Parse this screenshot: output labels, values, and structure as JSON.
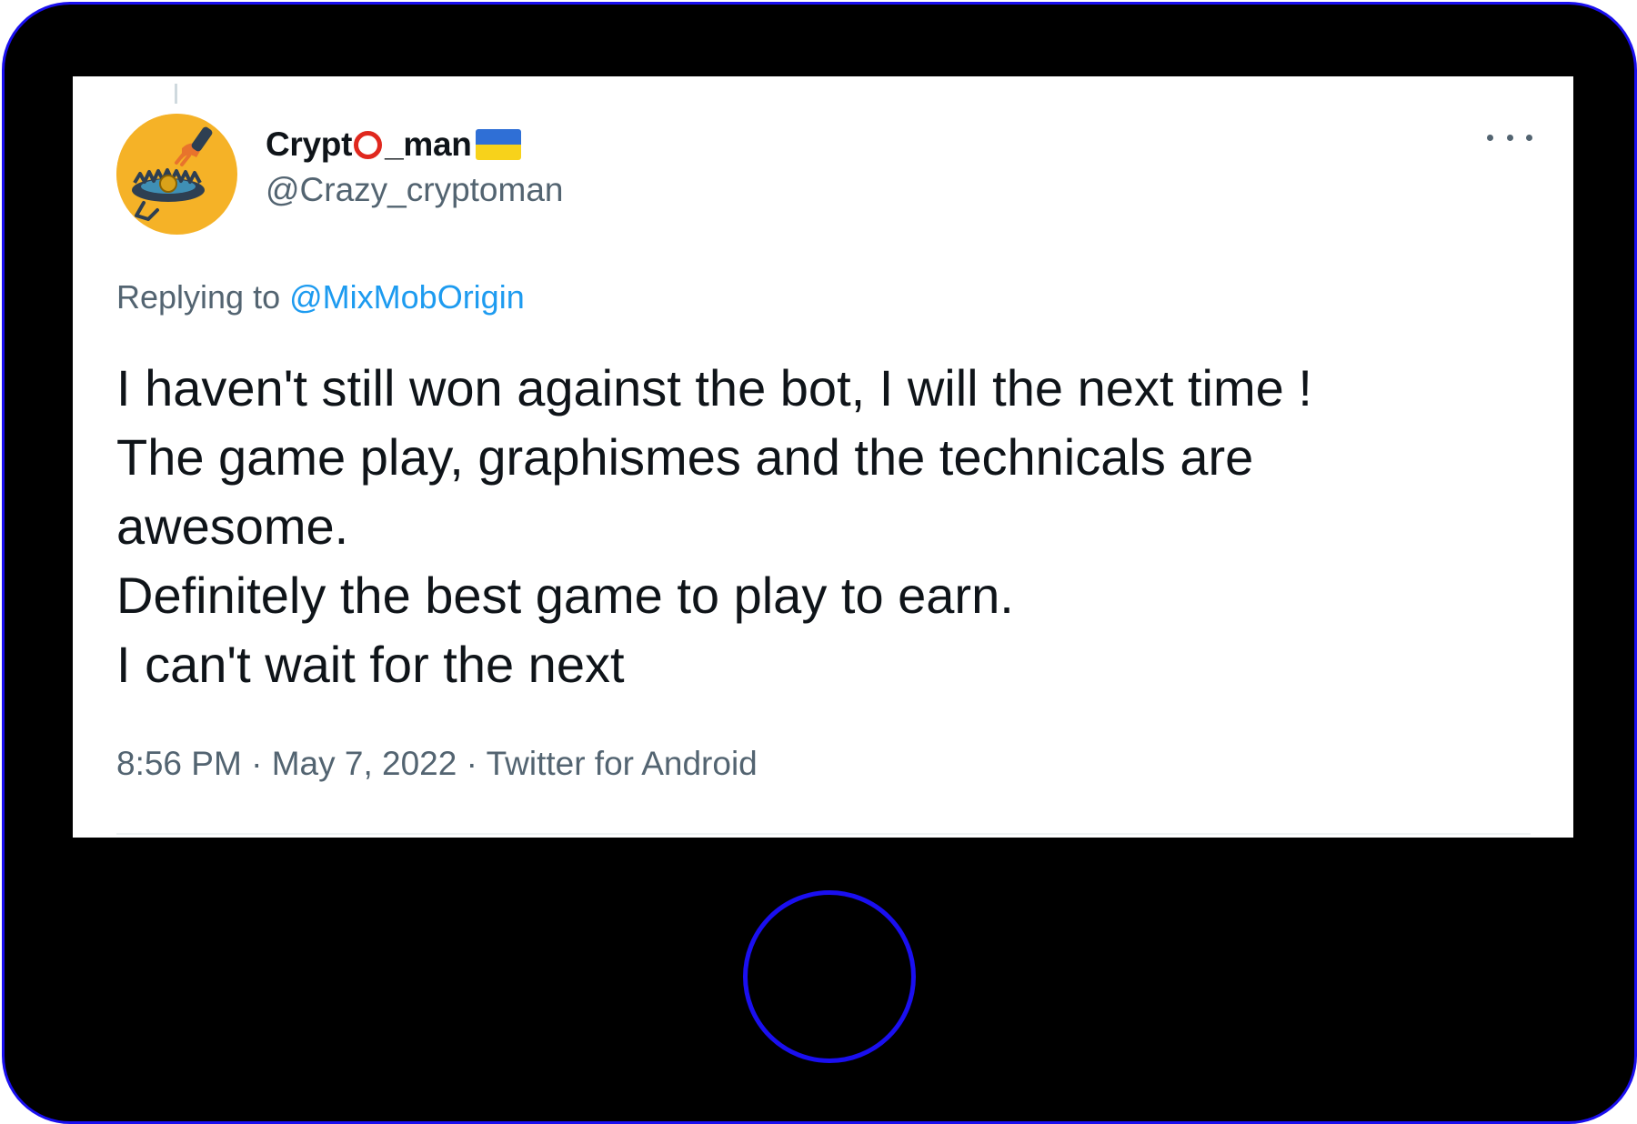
{
  "tweet": {
    "author": {
      "name_before": "Crypt",
      "name_after": "_man",
      "handle": "@Crazy_cryptoman",
      "avatar_icon": "bear-trap-icon",
      "name_emoji": [
        "red-circle-icon",
        "ukraine-flag-icon"
      ]
    },
    "reply": {
      "prefix": "Replying to",
      "mention": "@MixMobOrigin"
    },
    "text_lines": [
      "I haven't still won against the bot, I will the next time !",
      "The game play, graphismes and the technicals are",
      "awesome.",
      "Definitely the best game to play to earn.",
      "I can't wait for the next"
    ],
    "meta": {
      "time": "8:56 PM",
      "separator": "·",
      "date": "May 7, 2022",
      "source": "Twitter for Android"
    },
    "more_icon": "more-horizontal-icon"
  },
  "colors": {
    "device_frame": "#000000",
    "device_border": "#1a0ff0",
    "text_primary": "#0f1419",
    "text_secondary": "#536471",
    "link": "#1d9bf0",
    "avatar_bg": "#f5b227",
    "circle_emoji": "#e0281e",
    "flag_blue": "#2f6fd6",
    "flag_yellow": "#f7d21b"
  }
}
